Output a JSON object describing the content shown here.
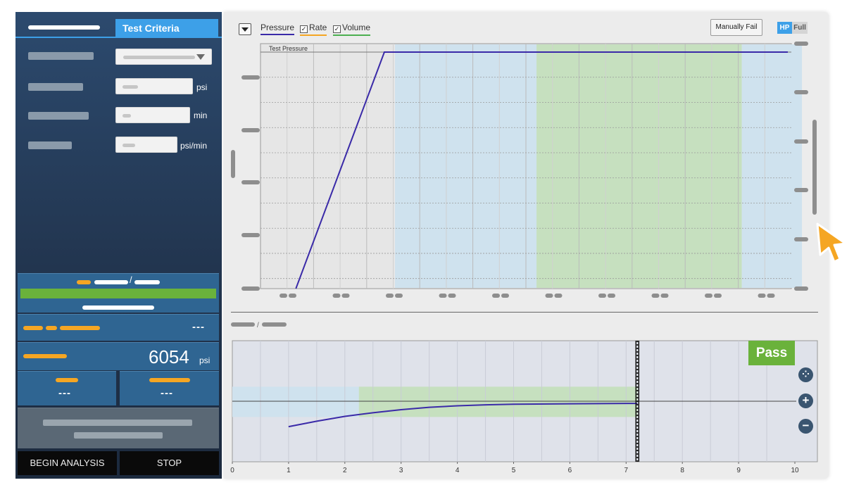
{
  "left_panel": {
    "tab_active_label": "Test Criteria",
    "units": {
      "pressure": "psi",
      "time": "min",
      "rate": "psi/min"
    },
    "pressure_readout": {
      "value": "6054",
      "unit": "psi"
    },
    "dash_values": {
      "row1": "---",
      "left": "---",
      "right": "---"
    },
    "progress_fraction": 1.0,
    "buttons": {
      "begin": "BEGIN ANALYSIS",
      "stop": "STOP"
    }
  },
  "toolbar": {
    "legend": [
      {
        "name": "Pressure",
        "checkbox": false,
        "color": "#3a2aa8"
      },
      {
        "name": "Rate",
        "checkbox": true,
        "checked": true,
        "color": "#f5a623"
      },
      {
        "name": "Volume",
        "checkbox": true,
        "checked": true,
        "color": "#4caf50"
      }
    ],
    "manual_fail": "Manually Fail",
    "hp_toggle": {
      "on": "HP",
      "off": "Full"
    }
  },
  "result_badge": "Pass",
  "zoom": {
    "fit": "⁘",
    "in": "+",
    "out": "−"
  },
  "colors": {
    "accent": "#3da0e8",
    "pass": "#6ab23b",
    "pressure_line": "#3a2aa8",
    "stage_blue": "#cfe2ee",
    "stage_green": "#c6e0bf"
  },
  "chart_data": [
    {
      "type": "line",
      "name": "pressure-chart",
      "annotation": "Test Pressure",
      "x_range": [
        0,
        100
      ],
      "y_range": [
        0,
        100
      ],
      "series": [
        {
          "values_xy": [
            [
              10,
              0
            ],
            [
              35,
              100
            ],
            [
              149,
              100
            ]
          ]
        }
      ],
      "bands": [
        {
          "from": 38,
          "to": 78,
          "color": "#cfe2ee"
        },
        {
          "from": 78,
          "to": 136,
          "color": "#c6e0bf"
        },
        {
          "from": 136,
          "to": 153,
          "color": "#cfe2ee"
        }
      ],
      "grid": true
    },
    {
      "type": "line",
      "name": "analysis-chart",
      "x_ticks": [
        "0",
        "1",
        "2",
        "3",
        "4",
        "5",
        "6",
        "7",
        "8",
        "9",
        "10"
      ],
      "x_range": [
        0,
        10
      ],
      "y_range": [
        0,
        10
      ],
      "series": [
        {
          "values_xy": [
            [
              1,
              2.9
            ],
            [
              1.5,
              3.35
            ],
            [
              2,
              3.75
            ],
            [
              2.5,
              4.05
            ],
            [
              3,
              4.3
            ],
            [
              3.5,
              4.5
            ],
            [
              4,
              4.62
            ],
            [
              4.5,
              4.7
            ],
            [
              5,
              4.75
            ],
            [
              6,
              4.79
            ],
            [
              7.2,
              4.82
            ]
          ]
        }
      ],
      "reference_line_y": 5,
      "current_x": 7.2,
      "bands": [
        {
          "from": 0,
          "to": 2.25,
          "color": "#cfe2ee"
        },
        {
          "from": 2.25,
          "to": 7.2,
          "color": "#c6e0bf"
        }
      ],
      "grid": true
    }
  ]
}
